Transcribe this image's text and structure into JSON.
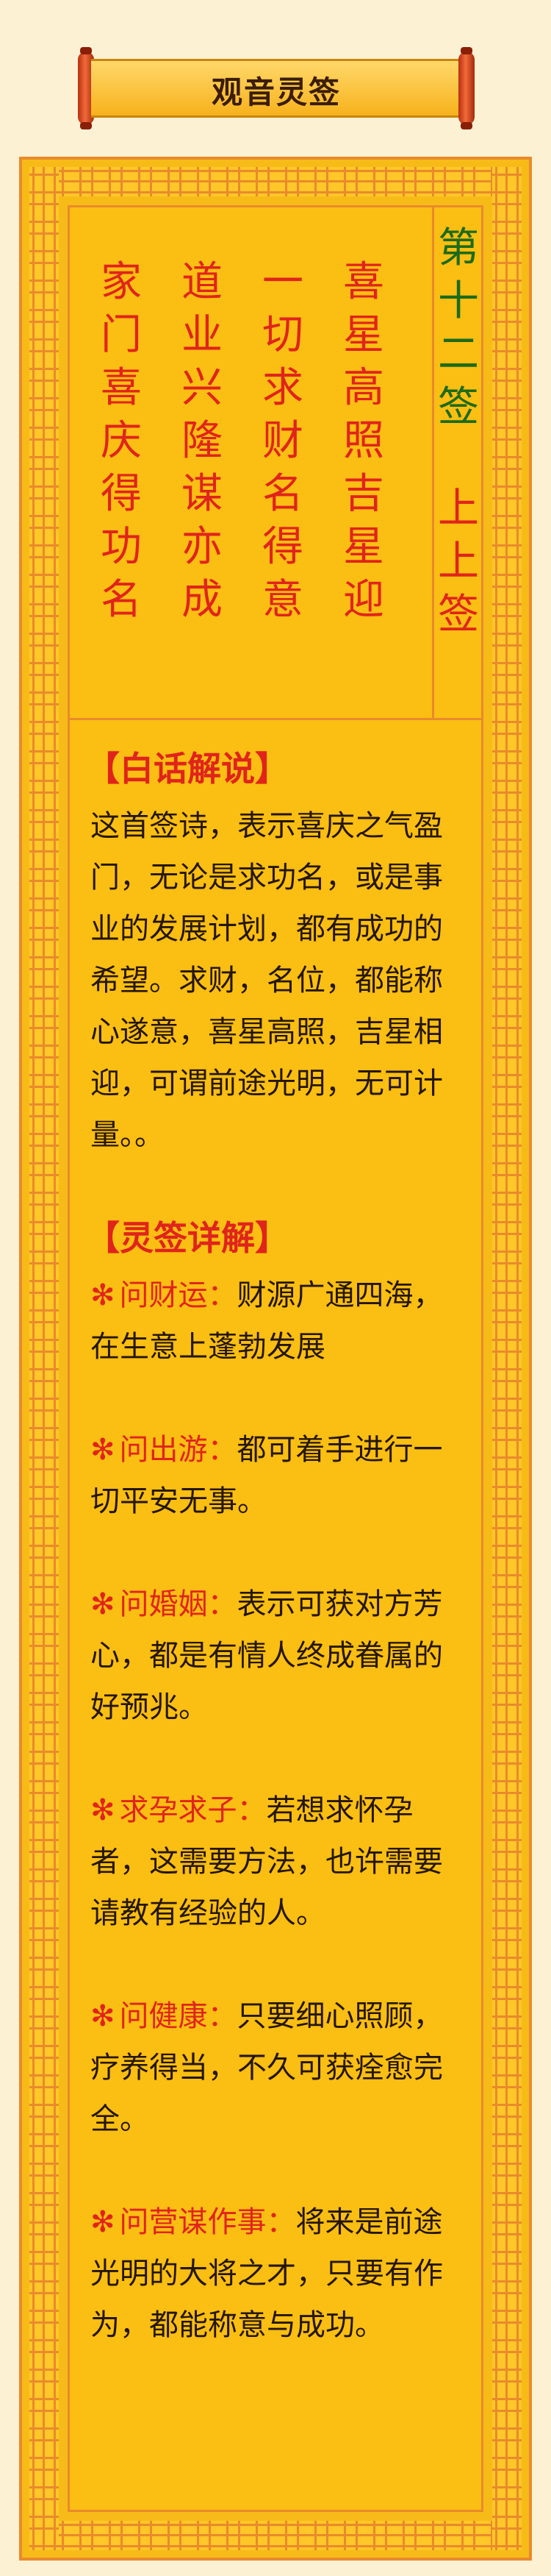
{
  "header": {
    "title": "观音灵签"
  },
  "poem": {
    "columns": [
      [
        "家",
        "门",
        "喜",
        "庆",
        "得",
        "功",
        "名"
      ],
      [
        "道",
        "业",
        "兴",
        "隆",
        "谋",
        "亦",
        "成"
      ],
      [
        "一",
        "切",
        "求",
        "财",
        "名",
        "得",
        "意"
      ],
      [
        "喜",
        "星",
        "高",
        "照",
        "吉",
        "星",
        "迎"
      ]
    ],
    "sign_number": [
      "第",
      "十",
      "二",
      "签"
    ],
    "sign_level": [
      "上",
      "上",
      "签"
    ]
  },
  "vernacular": {
    "heading": "【白话解说】",
    "text": "这首签诗，表示喜庆之气盈门，无论是求功名，或是事业的发展计划，都有成功的希望。求财，名位，都能称心遂意，喜星高照，吉星相迎，可谓前途光明，无可计量。。"
  },
  "details": {
    "heading": "【灵签详解】",
    "star": "✻",
    "items": [
      {
        "key": "问财运：",
        "text": "财源广通四海，在生意上蓬勃发展"
      },
      {
        "key": "问出游：",
        "text": "都可着手进行一切平安无事。"
      },
      {
        "key": "问婚姻：",
        "text": "表示可获对方芳心，都是有情人终成眷属的好预兆。"
      },
      {
        "key": "求孕求子：",
        "text": "若想求怀孕者，这需要方法，也许需要请教有经验的人。"
      },
      {
        "key": "问健康：",
        "text": "只要细心照顾，疗养得当，不久可获痊愈完全。"
      },
      {
        "key": "问营谋作事：",
        "text": "将来是前途光明的大将之才，只要有作为，都能称意与成功。"
      }
    ]
  },
  "colors": {
    "background": "#fdf1d4",
    "panel": "#f7bb18",
    "border": "#e98a2c",
    "accent_red": "#e0241c",
    "number_green": "#1d6b1a"
  }
}
